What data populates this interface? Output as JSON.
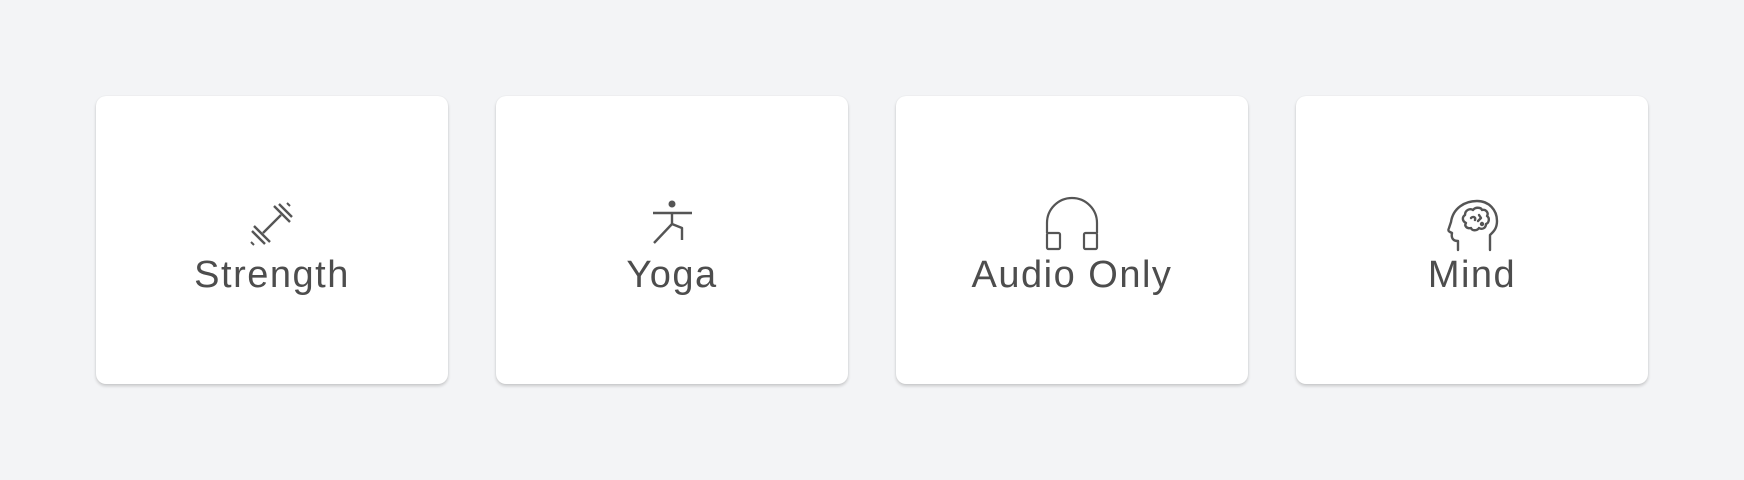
{
  "categories": [
    {
      "label": "Strength",
      "icon": "dumbbell-icon"
    },
    {
      "label": "Yoga",
      "icon": "yoga-pose-icon"
    },
    {
      "label": "Audio Only",
      "icon": "headphones-icon"
    },
    {
      "label": "Mind",
      "icon": "head-brain-icon"
    }
  ],
  "colors": {
    "background": "#f3f4f6",
    "card": "#ffffff",
    "text": "#4d4d4d",
    "icon": "#555555"
  }
}
